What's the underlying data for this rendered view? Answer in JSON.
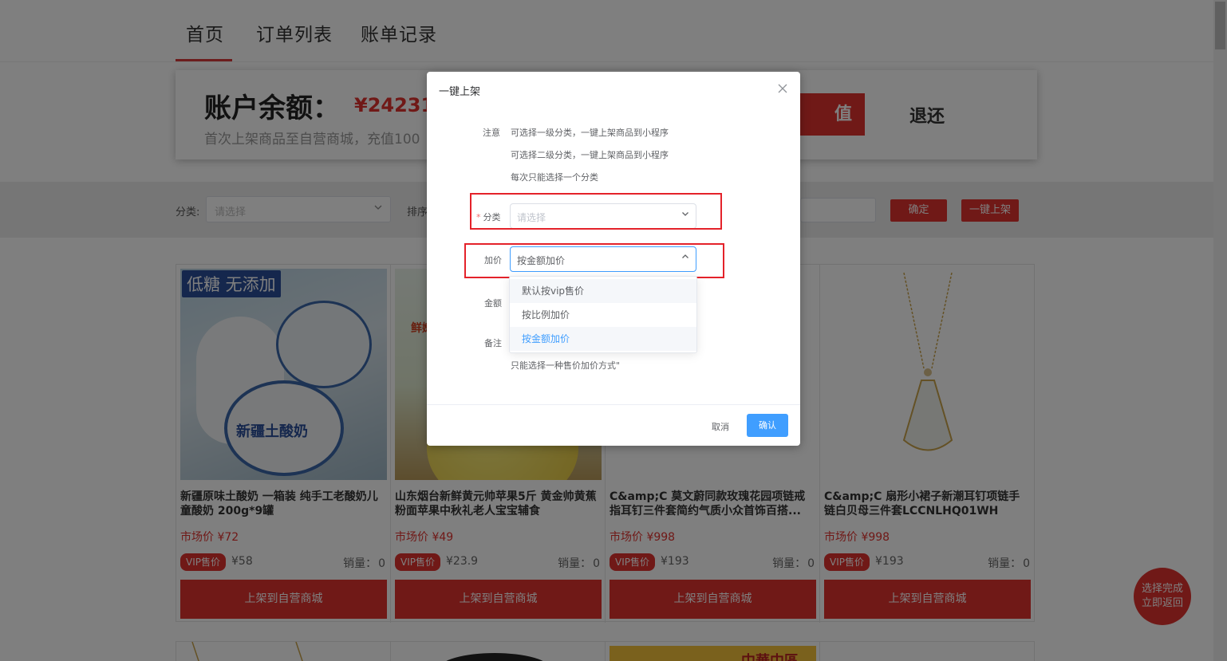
{
  "nav": {
    "items": [
      "首页",
      "订单列表",
      "账单记录"
    ]
  },
  "balance": {
    "label": "账户余额：",
    "value": "¥24231",
    "note": "首次上架商品至自营商城，充值100",
    "recharge_label": "值",
    "refund_label": "退还"
  },
  "filter": {
    "category_label": "分类:",
    "category_placeholder": "请选择",
    "sort_label": "排序",
    "confirm_label": "确定",
    "onekey_label": "一键上架"
  },
  "products": [
    {
      "title": "新疆原味土酸奶 一箱装 纯手工老酸奶儿童酸奶 200g*9罐",
      "market_price": "市场价 ¥72",
      "vip_label": "VIP售价",
      "vip_price": "¥58",
      "sales_label": "销量：",
      "sales": "0",
      "button": "上架到自营商城",
      "image_text": "低糖 无添加",
      "image_subtext": "新疆土酸奶"
    },
    {
      "title": "山东烟台新鲜黄元帅苹果5斤 黄金帅黄蕉粉面苹果中秋礼老人宝宝辅食",
      "market_price": "市场价 ¥49",
      "vip_label": "VIP售价",
      "vip_price": "¥23.9",
      "sales_label": "销量：",
      "sales": "0",
      "button": "上架到自营商城",
      "image_text": "鲜嫩"
    },
    {
      "title": "C&amp;C 莫文蔚同款玫瑰花园项链戒指耳钉三件套简约气质小众首饰百搭...",
      "market_price": "市场价 ¥998",
      "vip_label": "VIP售价",
      "vip_price": "¥193",
      "sales_label": "销量：",
      "sales": "0",
      "button": "上架到自营商城"
    },
    {
      "title": "C&amp;C 扇形小裙子新潮耳钉项链手链白贝母三件套LCCNLHQ01WH",
      "market_price": "市场价 ¥998",
      "vip_label": "VIP售价",
      "vip_price": "¥193",
      "sales_label": "销量：",
      "sales": "0",
      "button": "上架到自营商城"
    }
  ],
  "row2": {
    "third_image_text": "中華中區"
  },
  "float_button": {
    "line1": "选择完成",
    "line2": "立即返回"
  },
  "dialog": {
    "title": "一键上架",
    "note_label": "注意",
    "notes": [
      "可选择一级分类，一键上架商品到小程序",
      "可选择二级分类，一键上架商品到小程序",
      "每次只能选择一个分类"
    ],
    "required_mark": "*",
    "category_label": "分类",
    "category_placeholder": "请选择",
    "markup_label": "加价",
    "markup_value": "按金额加价",
    "amount_label": "金额",
    "remark_label": "备注",
    "dropdown_options": [
      "默认按vip售价",
      "按比例加价",
      "按金额加价"
    ],
    "tip": "只能选择一种售价加价方式\"",
    "cancel_label": "取消",
    "ok_label": "确认"
  },
  "colors": {
    "brand_red": "#e0322f",
    "primary_blue": "#409eff",
    "highlight_red": "#e4222a"
  }
}
